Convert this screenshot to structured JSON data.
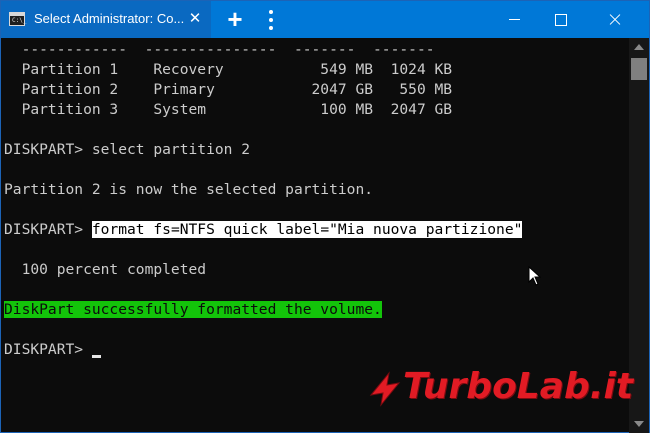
{
  "window": {
    "tab_title": "Select Administrator: Co...",
    "tab_close": "✕",
    "new_tab": "+",
    "icon_text": "C:\\_"
  },
  "console": {
    "lines": [
      "  ------------  ---------------  -------  -------",
      "  Partition 1    Recovery           549 MB  1024 KB",
      "  Partition 2    Primary           2047 GB   550 MB",
      "  Partition 3    System             100 MB  2047 GB",
      "",
      "DISKPART> select partition 2",
      "",
      "Partition 2 is now the selected partition.",
      "",
      "DISKPART> ",
      "",
      "  100 percent completed",
      "",
      "DiskPart successfully formatted the volume.",
      "",
      "DISKPART> "
    ],
    "selected_command": "format fs=NTFS quick label=\"Mia nuova partizione\""
  },
  "watermark": {
    "text": "TurboLab.it"
  },
  "colors": {
    "titlebar": "#0078d7",
    "console_bg": "#0c0c0c",
    "console_fg": "#cccccc",
    "success_highlight": "#13c40a",
    "watermark": "#e21b24"
  },
  "icons": [
    "console-app-icon",
    "close-icon",
    "plus-icon",
    "kebab-menu-icon",
    "minimize-icon",
    "maximize-icon",
    "close-window-icon",
    "mouse-pointer-icon",
    "scroll-up-icon",
    "scroll-down-icon",
    "turbolab-logo"
  ]
}
